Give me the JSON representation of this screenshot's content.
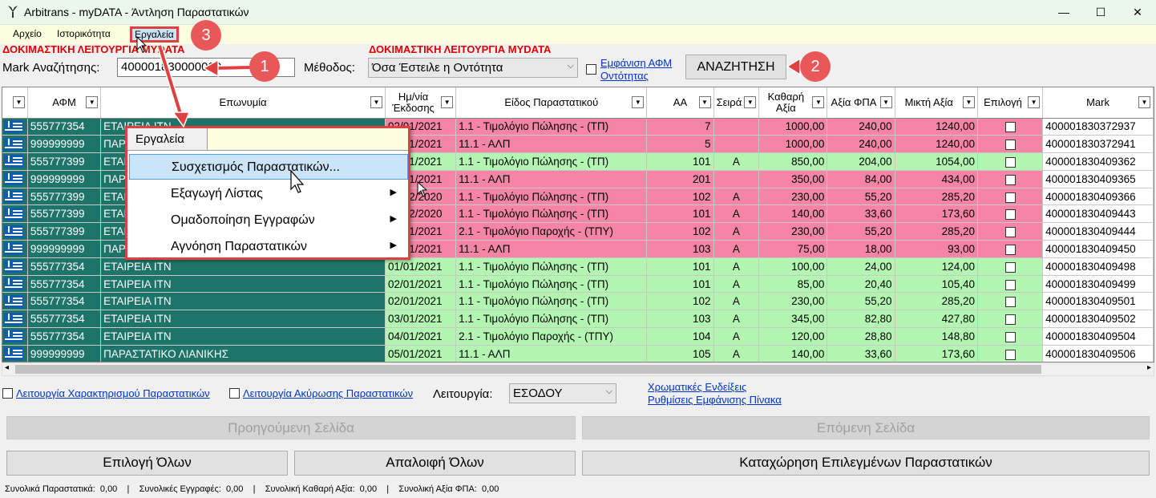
{
  "window": {
    "title": "Arbitrans - myDATA - Άντληση Παραστατικών",
    "minimize": "—",
    "maximize": "☐",
    "close": "✕"
  },
  "menubar": {
    "items": [
      "Αρχείο",
      "Ιστορικότητα",
      "Εργαλεία"
    ]
  },
  "test_mode_label": "ΔΟΚΙΜΑΣΤΙΚΗ ΛΕΙΤΟΥΡΓΙΑ MYDATA",
  "search": {
    "label": "Mark Αναζήτησης:",
    "value": "400001830000000",
    "method_label": "Μέθοδος:",
    "method_value": "Όσα Έστειλε η Οντότητα",
    "show_vat_label_1": "Εμφάνιση ΑΦΜ",
    "show_vat_label_2": "Οντότητας",
    "search_button": "ΑΝΑΖΗΤΗΣΗ"
  },
  "badges": [
    "1",
    "2",
    "3"
  ],
  "grid": {
    "columns": [
      "ΑΦΜ",
      "Επωνυμία",
      "Ημ/νία Έκδοσης",
      "Είδος Παραστατικού",
      "ΑΑ",
      "Σειρά",
      "Καθαρή Αξία",
      "Αξία ΦΠΑ",
      "Μικτή Αξία",
      "Επιλογή",
      "Mark"
    ],
    "rows": [
      {
        "status": "pink",
        "afm": "555777354",
        "name": "ΕΤΑΙΡΕΙΑ ΙΤΝ",
        "date": "02/01/2021",
        "type": "1.1 - Τιμολόγιο Πώλησης - (ΤΠ)",
        "aa": "7",
        "series": "",
        "net": "1000,00",
        "vat": "240,00",
        "gross": "1240,00",
        "mark": "400001830372937"
      },
      {
        "status": "pink",
        "afm": "999999999",
        "name": "ΠΑΡΑΣΤΑΤΙΚΟ ΛΙΑΝΙΚΗΣ",
        "date": "02/01/2021",
        "type": "11.1 - ΑΛΠ",
        "aa": "5",
        "series": "",
        "net": "1000,00",
        "vat": "240,00",
        "gross": "1240,00",
        "mark": "400001830372941"
      },
      {
        "status": "green",
        "afm": "555777399",
        "name": "ΕΤΑΙΡΕΙΑ ΙΤΝ",
        "date": "01/01/2021",
        "type": "1.1 - Τιμολόγιο Πώλησης - (ΤΠ)",
        "aa": "101",
        "series": "Α",
        "net": "850,00",
        "vat": "204,00",
        "gross": "1054,00",
        "mark": "400001830409362"
      },
      {
        "status": "pink",
        "afm": "999999999",
        "name": "ΠΑΡΑΣΤΑΤΙΚΟ ΛΙΑΝΙΚΗΣ",
        "date": "01/01/2021",
        "type": "11.1 - ΑΛΠ",
        "aa": "201",
        "series": "",
        "net": "350,00",
        "vat": "84,00",
        "gross": "434,00",
        "mark": "400001830409365"
      },
      {
        "status": "pink",
        "afm": "555777399",
        "name": "ΕΤΑΙΡΕΙΑ ΙΤΝ",
        "date": "31/12/2020",
        "type": "1.1 - Τιμολόγιο Πώλησης - (ΤΠ)",
        "aa": "102",
        "series": "Α",
        "net": "230,00",
        "vat": "55,20",
        "gross": "285,20",
        "mark": "400001830409366"
      },
      {
        "status": "pink",
        "afm": "555777399",
        "name": "ΕΤΑΙΡΕΙΑ ΙΤΝ",
        "date": "31/12/2020",
        "type": "1.1 - Τιμολόγιο Πώλησης - (ΤΠ)",
        "aa": "101",
        "series": "Α",
        "net": "140,00",
        "vat": "33,60",
        "gross": "173,60",
        "mark": "400001830409443"
      },
      {
        "status": "pink",
        "afm": "555777399",
        "name": "ΕΤΑΙΡΕΙΑ ΙΤΝ",
        "date": "01/01/2021",
        "type": "2.1 - Τιμολόγιο Παροχής - (ΤΠΥ)",
        "aa": "102",
        "series": "Α",
        "net": "230,00",
        "vat": "55,20",
        "gross": "285,20",
        "mark": "400001830409444"
      },
      {
        "status": "pink",
        "afm": "999999999",
        "name": "ΠΑΡΑΣΤΑΤΙΚΟ ΛΙΑΝΙΚΗΣ",
        "date": "01/01/2021",
        "type": "11.1 - ΑΛΠ",
        "aa": "103",
        "series": "Α",
        "net": "75,00",
        "vat": "18,00",
        "gross": "93,00",
        "mark": "400001830409450"
      },
      {
        "status": "green",
        "afm": "555777354",
        "name": "ΕΤΑΙΡΕΙΑ ΙΤΝ",
        "date": "01/01/2021",
        "type": "1.1 - Τιμολόγιο Πώλησης - (ΤΠ)",
        "aa": "101",
        "series": "Α",
        "net": "100,00",
        "vat": "24,00",
        "gross": "124,00",
        "mark": "400001830409498"
      },
      {
        "status": "green",
        "afm": "555777354",
        "name": "ΕΤΑΙΡΕΙΑ ΙΤΝ",
        "date": "02/01/2021",
        "type": "1.1 - Τιμολόγιο Πώλησης - (ΤΠ)",
        "aa": "101",
        "series": "Α",
        "net": "85,00",
        "vat": "20,40",
        "gross": "105,40",
        "mark": "400001830409499"
      },
      {
        "status": "green",
        "afm": "555777354",
        "name": "ΕΤΑΙΡΕΙΑ ΙΤΝ",
        "date": "02/01/2021",
        "type": "1.1 - Τιμολόγιο Πώλησης - (ΤΠ)",
        "aa": "102",
        "series": "Α",
        "net": "230,00",
        "vat": "55,20",
        "gross": "285,20",
        "mark": "400001830409501"
      },
      {
        "status": "green",
        "afm": "555777354",
        "name": "ΕΤΑΙΡΕΙΑ ΙΤΝ",
        "date": "03/01/2021",
        "type": "1.1 - Τιμολόγιο Πώλησης - (ΤΠ)",
        "aa": "103",
        "series": "Α",
        "net": "345,00",
        "vat": "82,80",
        "gross": "427,80",
        "mark": "400001830409502"
      },
      {
        "status": "green",
        "afm": "555777354",
        "name": "ΕΤΑΙΡΕΙΑ ΙΤΝ",
        "date": "04/01/2021",
        "type": "2.1 - Τιμολόγιο Παροχής - (ΤΠΥ)",
        "aa": "104",
        "series": "Α",
        "net": "120,00",
        "vat": "28,80",
        "gross": "148,80",
        "mark": "400001830409504"
      },
      {
        "status": "green",
        "afm": "999999999",
        "name": "ΠΑΡΑΣΤΑΤΙΚΟ ΛΙΑΝΙΚΗΣ",
        "date": "05/01/2021",
        "type": "11.1 - ΑΛΠ",
        "aa": "105",
        "series": "Α",
        "net": "140,00",
        "vat": "33,60",
        "gross": "173,60",
        "mark": "400001830409506"
      }
    ]
  },
  "context_menu": {
    "header": "Εργαλεία",
    "items": [
      "Συσχετισμός Παραστατικών...",
      "Εξαγωγή Λίστας",
      "Ομαδοποίηση Εγγραφών",
      "Αγνόηση Παραστατικών"
    ]
  },
  "bottom": {
    "char_mode_label": "Λειτουργία Χαρακτηρισμού Παραστατικών",
    "cancel_mode_label": "Λειτουργία Ακύρωσης Παραστατικών",
    "operation_label": "Λειτουργία:",
    "operation_value": "ΕΣΟΔΟΥ",
    "color_link": "Χρωματικές Ενδείξεις",
    "table_settings_link": "Ρυθμίσεις Εμφάνισης Πίνακα",
    "prev_page": "Προηγούμενη Σελίδα",
    "next_page": "Επόμενη Σελίδα",
    "select_all": "Επιλογή Όλων",
    "clear_all": "Απαλοιφή Όλων",
    "register_selected": "Καταχώρηση Επιλεγμένων Παραστατικών"
  },
  "status": {
    "text": "Συνολικά Παραστατικά:  0,00    |    Συνολικές Εγγραφές:  0,00    |    Συνολική Καθαρή Αξία:  0,00    |    Συνολική Αξία ΦΠΑ:  0,00"
  },
  "colors": {
    "pink": "#f585a6",
    "green": "#b2f6b2",
    "teal": "#1e7468",
    "callout": "#e85858"
  }
}
